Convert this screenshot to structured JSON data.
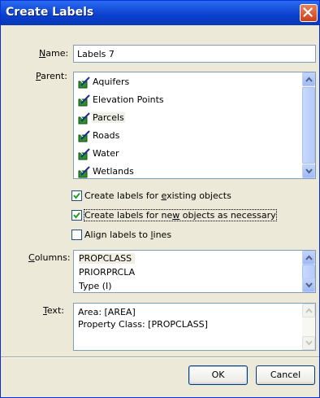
{
  "window": {
    "title": "Create Labels",
    "close_icon": "close-icon"
  },
  "name_field": {
    "label_prefix": "",
    "label_accel": "N",
    "label_rest": "ame:",
    "value": "Labels 7"
  },
  "parent_list": {
    "label_accel": "P",
    "label_rest": "arent:",
    "items": [
      {
        "label": "Aquifers",
        "icon": "feature-class-icon"
      },
      {
        "label": "Elevation Points",
        "icon": "feature-class-icon"
      },
      {
        "label": "Parcels",
        "icon": "feature-class-icon",
        "selected": true
      },
      {
        "label": "Roads",
        "icon": "feature-class-icon"
      },
      {
        "label": "Water",
        "icon": "feature-class-icon"
      },
      {
        "label": "Wetlands",
        "icon": "feature-class-icon"
      }
    ]
  },
  "options": {
    "existing": {
      "pre": "Create labels for ",
      "accel": "e",
      "post": "xisting objects",
      "checked": true
    },
    "new": {
      "pre": "Create labels for ne",
      "accel": "w",
      "post": " objects as necessary",
      "checked": true
    },
    "align": {
      "pre": "Align labels to ",
      "accel": "l",
      "post": "ines",
      "checked": false
    }
  },
  "columns": {
    "label_accel": "C",
    "label_rest": "olumns:",
    "items": [
      "PROPCLASS",
      "PRIORPRCLA",
      "Type (I)"
    ]
  },
  "text_field": {
    "label_accel": "T",
    "label_rest": "ext:",
    "lines": [
      "Area: [AREA]",
      "Property Class: [PROPCLASS]"
    ]
  },
  "buttons": {
    "ok": "OK",
    "cancel": "Cancel"
  },
  "colors": {
    "title_bar": "#0a3fce",
    "dialog_bg": "#ece9d8",
    "close_button": "#c9411b"
  }
}
